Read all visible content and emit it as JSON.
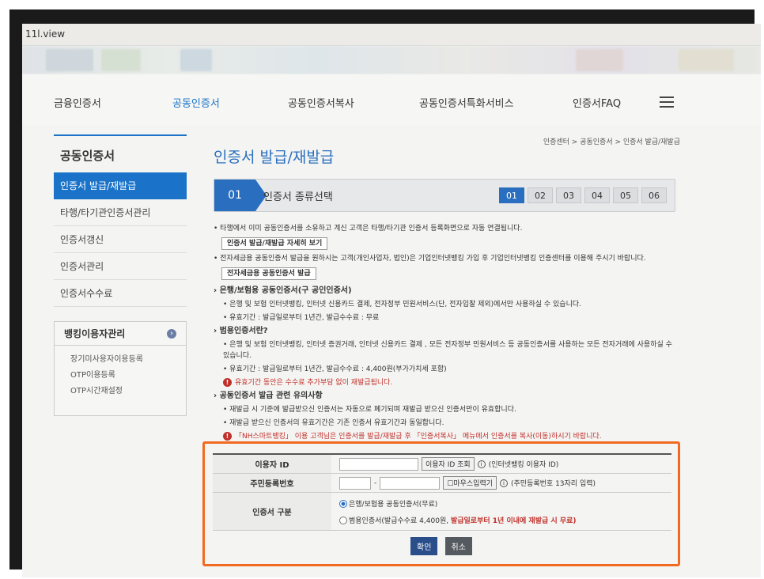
{
  "browser": {
    "url_fragment": "11l.view"
  },
  "topnav": {
    "items": [
      "금융인증서",
      "공동인증서",
      "공동인증서복사",
      "공동인증서특화서비스",
      "인증서FAQ"
    ],
    "active_index": 1
  },
  "sidebar": {
    "title": "공동인증서",
    "items": [
      "인증서 발급/재발급",
      "타행/타기관인증서관리",
      "인증서갱신",
      "인증서관리",
      "인증서수수료"
    ],
    "banking_title": "뱅킹이용자관리",
    "banking_items": [
      "장기미사용자이용등록",
      "OTP이용등록",
      "OTP시간재설정"
    ]
  },
  "main": {
    "breadcrumb": "인증센터 > 공동인증서 > 인증서 발급/재발급",
    "title": "인증서 발급/재발급",
    "step_current": "01",
    "step_label": "인증서 종류선택",
    "steps": [
      "01",
      "02",
      "03",
      "04",
      "05",
      "06"
    ],
    "p1": "• 타행에서 이미 공동인증서를 소유하고 계신 고객은 타행/타기관 인증서 등록화면으로 자동 연결됩니다.",
    "btn_detail": "인증서 발급/재발급 자세히 보기",
    "p2": "• 전자세금용 공동인증서 발급을 원하시는 고객(개인사업자, 법인)은 기업인터넷뱅킹 가입 후 기업인터넷뱅킹 인증센터를 이용해 주시기 바랍니다.",
    "btn_tax": "전자세금용 공동인증서 발급",
    "h1": "› 은행/보험용 공동인증서(구 공인인증서)",
    "h1_l1": "• 은행 및 보험 인터넷뱅킹, 인터넷 신용카드 결제, 전자정부 민원서비스(단, 전자입찰 제외)에서만 사용하실 수 있습니다.",
    "h1_l2": "• 유효기간 : 발급일로부터 1년간, 발급수수료 : 무료",
    "h2": "› 범용인증서란?",
    "h2_l1": "• 은행 및 보험 인터넷뱅킹, 인터넷 증권거래, 인터넷 신용카드 결제 , 모든 전자정부 민원서비스 등 공동인증서를 사용하는 모든 전자거래에 사용하실 수 있습니다.",
    "h2_l2": "• 유효기간 : 발급일로부터 1년간, 발급수수료 : 4,400원(부가가치세 포함)",
    "h2_warn": "유효기간 동안은 수수료 추가부담 없이 재발급됩니다.",
    "h3": "› 공동인증서 발급 관련 유의사항",
    "h3_l1": "• 재발급 시 기준에 발급받으신 인증서는 자동으로 폐기되며 재발급 받으신 인증서만이 유효합니다.",
    "h3_l2": "• 재발급 받으신 인증서의 유효기간은 기존 인증서 유효기간과 동일합니다.",
    "h3_warn": "「NH스마트뱅킹」 이용 고객님은 인증서를 발급/재발급 후 「인증서복사」 메뉴에서 인증서를 복사(이동)하시기 바랍니다."
  },
  "form": {
    "id_label": "이용자 ID",
    "id_lookup": "이용자 ID 조회",
    "id_hint": "(인터넷뱅킹 이용자 ID)",
    "rrn_label": "주민등록번호",
    "rrn_mouse": "마우스입력기",
    "rrn_hint": "(주민등록번호 13자리 입력)",
    "type_label": "인증서 구분",
    "opt1": "은행/보험용 공동인증서(무료)",
    "opt2": "범용인증서(발급수수료 4,400원,",
    "opt2_red": "발급일로부터 1년 이내에 재발급 시 무료)",
    "confirm": "확인",
    "cancel": "취소"
  }
}
